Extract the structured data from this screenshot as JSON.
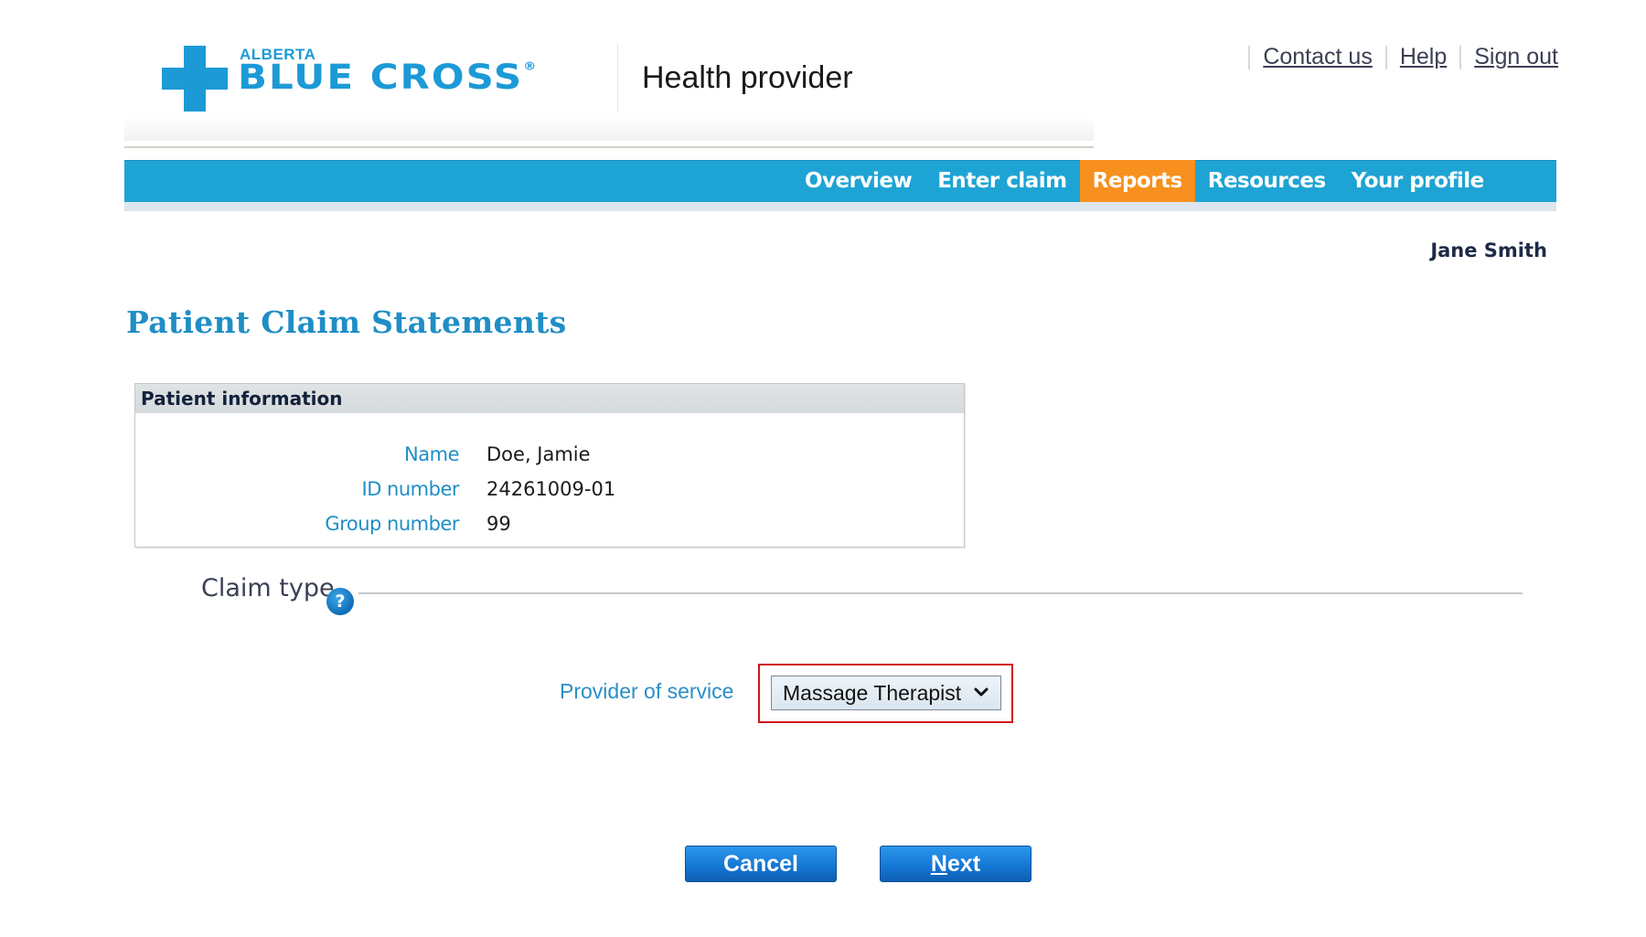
{
  "header": {
    "logo": {
      "line1": "ALBERTA",
      "line2": "BLUE CROSS",
      "registered": "®",
      "brand_color": "#1c9ad6"
    },
    "app_title": "Health provider",
    "links": [
      {
        "label": "Contact us"
      },
      {
        "label": "Help"
      },
      {
        "label": "Sign out"
      }
    ]
  },
  "nav": {
    "items": [
      {
        "label": "Overview",
        "active": false
      },
      {
        "label": "Enter claim",
        "active": false
      },
      {
        "label": "Reports",
        "active": true
      },
      {
        "label": "Resources",
        "active": false
      },
      {
        "label": "Your profile",
        "active": false
      }
    ],
    "bar_color": "#1ea4d4",
    "active_color": "#f7901e"
  },
  "user": {
    "name": "Jane Smith"
  },
  "page": {
    "title": "Patient Claim Statements"
  },
  "patient_info": {
    "heading": "Patient information",
    "rows": [
      {
        "label": "Name",
        "value": "Doe, Jamie"
      },
      {
        "label": "ID number",
        "value": "24261009-01"
      },
      {
        "label": "Group number",
        "value": "99"
      }
    ]
  },
  "claim_type": {
    "heading": "Claim type",
    "help_icon": "?",
    "provider_label": "Provider of service",
    "provider_selected": "Massage Therapist"
  },
  "actions": {
    "cancel_label": "Cancel",
    "next_mnemonic": "N",
    "next_rest": "ext"
  }
}
